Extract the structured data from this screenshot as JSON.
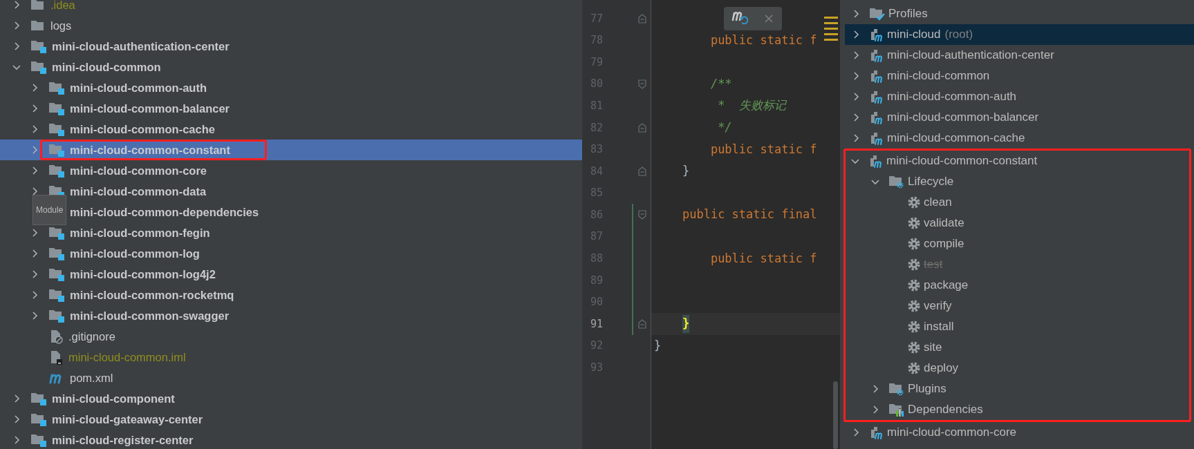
{
  "project_tree": [
    {
      "label": ".idea",
      "kind": "folder",
      "expanded": false,
      "ignored": true,
      "selected": false
    },
    {
      "label": "logs",
      "kind": "folder",
      "expanded": false,
      "ignored": false,
      "selected": false
    },
    {
      "label": "mini-cloud-authentication-center",
      "kind": "module",
      "expanded": false,
      "ignored": false,
      "selected": false
    },
    {
      "label": "mini-cloud-common",
      "kind": "module",
      "expanded": true,
      "ignored": false,
      "selected": false,
      "children": [
        {
          "label": "mini-cloud-common-auth",
          "kind": "module",
          "expanded": false,
          "ignored": false,
          "selected": false
        },
        {
          "label": "mini-cloud-common-balancer",
          "kind": "module",
          "expanded": false,
          "ignored": false,
          "selected": false
        },
        {
          "label": "mini-cloud-common-cache",
          "kind": "module",
          "expanded": false,
          "ignored": false,
          "selected": false
        },
        {
          "label": "mini-cloud-common-constant",
          "kind": "module",
          "expanded": false,
          "ignored": false,
          "selected": true,
          "annotated": true
        },
        {
          "label": "mini-cloud-common-core",
          "kind": "module",
          "expanded": false,
          "ignored": false,
          "selected": false
        },
        {
          "label": "mini-cloud-common-data",
          "kind": "module",
          "expanded": false,
          "ignored": false,
          "selected": false
        },
        {
          "label": "mini-cloud-common-dependencies",
          "kind": "module",
          "expanded": false,
          "ignored": false,
          "selected": false
        },
        {
          "label": "mini-cloud-common-fegin",
          "kind": "module",
          "expanded": false,
          "ignored": false,
          "selected": false
        },
        {
          "label": "mini-cloud-common-log",
          "kind": "module",
          "expanded": false,
          "ignored": false,
          "selected": false
        },
        {
          "label": "mini-cloud-common-log4j2",
          "kind": "module",
          "expanded": false,
          "ignored": false,
          "selected": false
        },
        {
          "label": "mini-cloud-common-rocketmq",
          "kind": "module",
          "expanded": false,
          "ignored": false,
          "selected": false
        },
        {
          "label": "mini-cloud-common-swagger",
          "kind": "module",
          "expanded": false,
          "ignored": false,
          "selected": false
        },
        {
          "label": ".gitignore",
          "kind": "gitignore",
          "ignored": false,
          "selected": false
        },
        {
          "label": "mini-cloud-common.iml",
          "kind": "iml",
          "ignored": true,
          "selected": false
        },
        {
          "label": "pom.xml",
          "kind": "pom",
          "ignored": false,
          "selected": false
        }
      ]
    },
    {
      "label": "mini-cloud-component",
      "kind": "module",
      "expanded": false,
      "ignored": false,
      "selected": false
    },
    {
      "label": "mini-cloud-gateaway-center",
      "kind": "module",
      "expanded": false,
      "ignored": false,
      "selected": false
    },
    {
      "label": "mini-cloud-register-center",
      "kind": "module",
      "expanded": false,
      "ignored": false,
      "selected": false
    }
  ],
  "tooltip": {
    "text": "Module"
  },
  "editor": {
    "lines": [
      {
        "number": "77",
        "fold_start": false,
        "fold_end": true,
        "current": false,
        "changed": false
      },
      {
        "number": "78",
        "code": "        public static f",
        "kind": "keyword",
        "fold_start": false,
        "fold_end": false,
        "current": false,
        "changed": false
      },
      {
        "number": "79",
        "fold_start": false,
        "fold_end": false,
        "current": false,
        "changed": false
      },
      {
        "number": "80",
        "code": "        /**",
        "kind": "comment",
        "fold_start": true,
        "fold_end": false,
        "current": false,
        "changed": false
      },
      {
        "number": "81",
        "code": "         *  失败标记",
        "kind": "comment",
        "fold_start": false,
        "fold_end": false,
        "current": false,
        "changed": false
      },
      {
        "number": "82",
        "code": "         */",
        "kind": "comment",
        "fold_start": false,
        "fold_end": true,
        "current": false,
        "changed": false
      },
      {
        "number": "83",
        "code": "        public static f",
        "kind": "keyword",
        "fold_start": false,
        "fold_end": false,
        "current": false,
        "changed": false
      },
      {
        "number": "84",
        "code": "    }",
        "kind": "brace",
        "fold_start": false,
        "fold_end": true,
        "current": false,
        "changed": false
      },
      {
        "number": "85",
        "fold_start": false,
        "fold_end": false,
        "current": false,
        "changed": false
      },
      {
        "number": "86",
        "code": "    public static final",
        "kind": "keyword",
        "fold_start": true,
        "fold_end": false,
        "current": false,
        "changed": true
      },
      {
        "number": "87",
        "fold_start": false,
        "fold_end": false,
        "current": false,
        "changed": true
      },
      {
        "number": "88",
        "code": "        public static f",
        "kind": "keyword",
        "fold_start": false,
        "fold_end": false,
        "current": false,
        "changed": true
      },
      {
        "number": "89",
        "fold_start": false,
        "fold_end": false,
        "current": false,
        "changed": true
      },
      {
        "number": "90",
        "fold_start": false,
        "fold_end": false,
        "current": false,
        "changed": true
      },
      {
        "number": "91",
        "code": "    }",
        "kind": "matched_brace",
        "fold_start": false,
        "fold_end": true,
        "current": true,
        "changed": true
      },
      {
        "number": "92",
        "code": "}",
        "kind": "brace",
        "fold_start": false,
        "fold_end": false,
        "current": false,
        "changed": false
      },
      {
        "number": "93",
        "fold_start": false,
        "fold_end": false,
        "current": false,
        "changed": false
      }
    ]
  },
  "maven_tree": [
    {
      "label": "Profiles",
      "kind": "profiles",
      "expanded": false,
      "selected": false
    },
    {
      "label": "mini-cloud",
      "suffix": "(root)",
      "kind": "project",
      "expanded": false,
      "selected": true
    },
    {
      "label": "mini-cloud-authentication-center",
      "kind": "project",
      "expanded": false,
      "selected": false
    },
    {
      "label": "mini-cloud-common",
      "kind": "project",
      "expanded": false,
      "selected": false
    },
    {
      "label": "mini-cloud-common-auth",
      "kind": "project",
      "expanded": false,
      "selected": false
    },
    {
      "label": "mini-cloud-common-balancer",
      "kind": "project",
      "expanded": false,
      "selected": false
    },
    {
      "label": "mini-cloud-common-cache",
      "kind": "project",
      "expanded": false,
      "selected": false
    },
    {
      "label": "mini-cloud-common-constant",
      "kind": "project",
      "expanded": true,
      "selected": false,
      "annotated": true,
      "children": [
        {
          "label": "Lifecycle",
          "kind": "lifecycle",
          "expanded": true,
          "selected": false,
          "children": [
            {
              "label": "clean",
              "kind": "goal",
              "disabled": false,
              "selected": false
            },
            {
              "label": "validate",
              "kind": "goal",
              "disabled": false,
              "selected": false
            },
            {
              "label": "compile",
              "kind": "goal",
              "disabled": false,
              "selected": false
            },
            {
              "label": "test",
              "kind": "goal",
              "disabled": true,
              "selected": false
            },
            {
              "label": "package",
              "kind": "goal",
              "disabled": false,
              "selected": false
            },
            {
              "label": "verify",
              "kind": "goal",
              "disabled": false,
              "selected": false
            },
            {
              "label": "install",
              "kind": "goal",
              "disabled": false,
              "selected": false
            },
            {
              "label": "site",
              "kind": "goal",
              "disabled": false,
              "selected": false
            },
            {
              "label": "deploy",
              "kind": "goal",
              "disabled": false,
              "selected": false
            }
          ]
        },
        {
          "label": "Plugins",
          "kind": "plugins",
          "expanded": false,
          "selected": false
        },
        {
          "label": "Dependencies",
          "kind": "dependencies",
          "expanded": false,
          "selected": false
        }
      ]
    },
    {
      "label": "mini-cloud-common-core",
      "kind": "project",
      "expanded": false,
      "selected": false
    }
  ]
}
